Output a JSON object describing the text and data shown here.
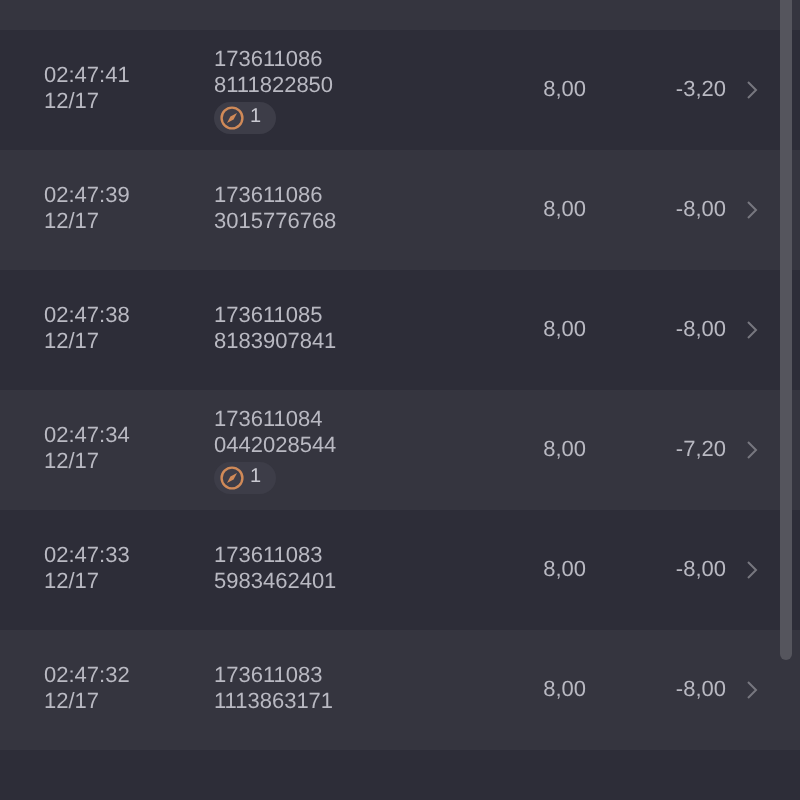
{
  "rows": [
    {
      "time": "02:47:41",
      "date": "12/17",
      "id_line_1": "173611086",
      "id_line_2": "8111822850",
      "badge": "1",
      "amount": "8,00",
      "change": "-3,20"
    },
    {
      "time": "02:47:39",
      "date": "12/17",
      "id_line_1": "173611086",
      "id_line_2": "3015776768",
      "amount": "8,00",
      "change": "-8,00"
    },
    {
      "time": "02:47:38",
      "date": "12/17",
      "id_line_1": "173611085",
      "id_line_2": "8183907841",
      "amount": "8,00",
      "change": "-8,00"
    },
    {
      "time": "02:47:34",
      "date": "12/17",
      "id_line_1": "173611084",
      "id_line_2": "0442028544",
      "badge": "1",
      "amount": "8,00",
      "change": "-7,20"
    },
    {
      "time": "02:47:33",
      "date": "12/17",
      "id_line_1": "173611083",
      "id_line_2": "5983462401",
      "amount": "8,00",
      "change": "-8,00"
    },
    {
      "time": "02:47:32",
      "date": "12/17",
      "id_line_1": "173611083",
      "id_line_2": "1113863171",
      "amount": "8,00",
      "change": "-8,00"
    }
  ]
}
